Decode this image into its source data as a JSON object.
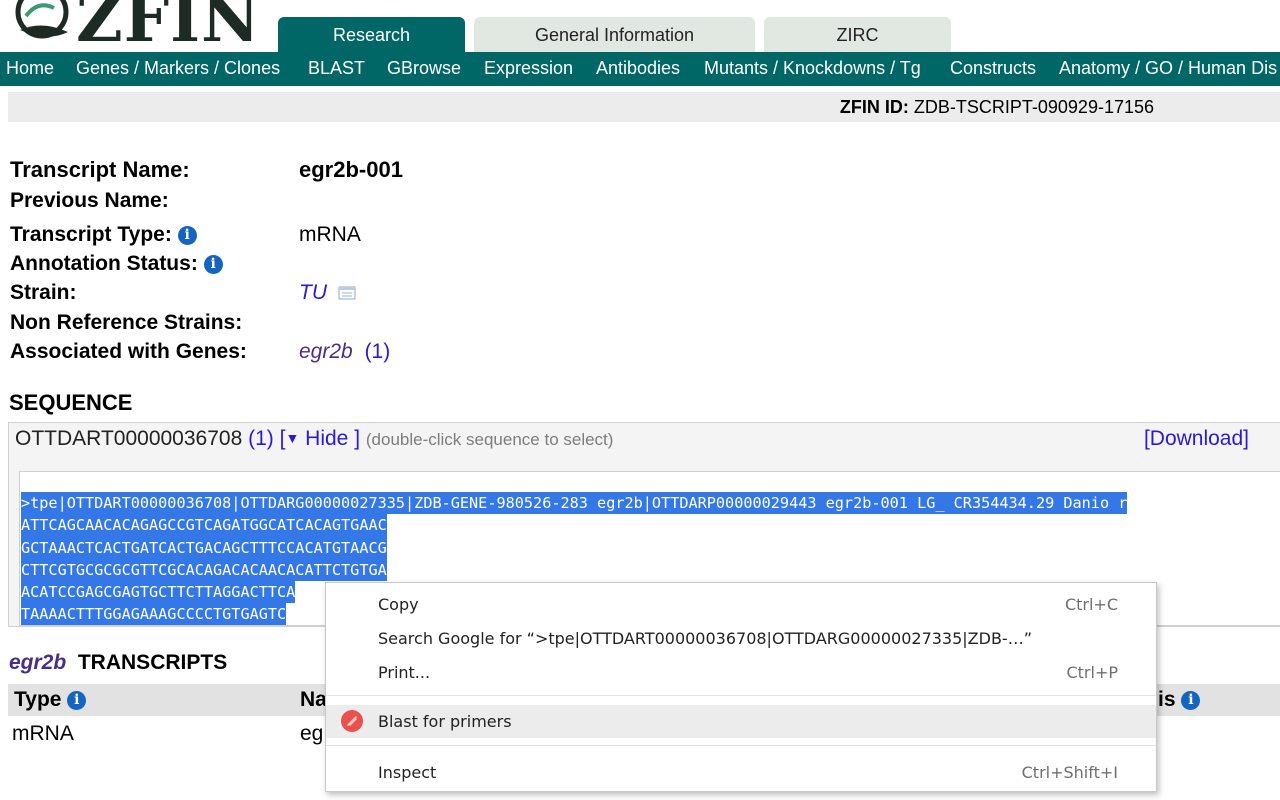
{
  "header": {
    "logo_text": "ZFIN",
    "tabs": [
      {
        "label": "Research",
        "active": true
      },
      {
        "label": "General Information",
        "active": false
      },
      {
        "label": "ZIRC",
        "active": false
      }
    ],
    "nav": [
      "Home",
      "Genes / Markers / Clones",
      "BLAST",
      "GBrowse",
      "Expression",
      "Antibodies",
      "Mutants / Knockdowns / Tg",
      "Constructs",
      "Anatomy / GO / Human Dis"
    ]
  },
  "zfin_id": {
    "label": "ZFIN ID:",
    "value": "ZDB-TSCRIPT-090929-17156"
  },
  "fields": {
    "transcript_name": {
      "label": "Transcript Name:",
      "value": "egr2b-001"
    },
    "previous_name": {
      "label": "Previous Name:"
    },
    "transcript_type": {
      "label": "Transcript Type:",
      "value": "mRNA"
    },
    "annotation_status": {
      "label": "Annotation Status:"
    },
    "strain": {
      "label": "Strain:",
      "value": "TU"
    },
    "non_reference_strains": {
      "label": "Non Reference Strains:"
    },
    "associated_genes": {
      "label": "Associated with Genes:",
      "gene": "egr2b",
      "count": "(1)"
    }
  },
  "sequence": {
    "title": "SEQUENCE",
    "accession": "OTTDART00000036708",
    "count": "(1)",
    "hide_label": "Hide",
    "hint": "(double-click sequence to select)",
    "download": "[Download]",
    "lines": [
      ">tpe|OTTDART00000036708|OTTDARG00000027335|ZDB-GENE-980526-283 egr2b|OTTDARP00000029443 egr2b-001 LG_ CR354434.29 Danio r",
      "ATTCAGCAACACAGAGCCGTCAGATGGCATCACAGTGAAC",
      "GCTAAACTCACTGATCACTGACAGCTTTCCACATGTAACG",
      "CTTCGTGCGCGCGTTCGCACAGACACAACACATTCTGTGA",
      "ACATCCGAGCGAGTGCTTCTTAGGACTTCA",
      "TAAAACTTTGGAGAAAGCCCCTGTGAGTC"
    ]
  },
  "transcripts": {
    "gene": "egr2b",
    "title": "TRANSCRIPTS",
    "columns": [
      "Type",
      "Na",
      "is"
    ],
    "row": {
      "type": "mRNA",
      "name": "eg"
    }
  },
  "context_menu": {
    "items": [
      {
        "label": "Copy",
        "shortcut": "Ctrl+C"
      },
      {
        "label": "Search Google for “>tpe|OTTDART00000036708|OTTDARG00000027335|ZDB-…”",
        "shortcut": ""
      },
      {
        "label": "Print...",
        "shortcut": "Ctrl+P"
      },
      {
        "label": "Blast for primers",
        "shortcut": "",
        "icon": "blast-primer-icon"
      },
      {
        "label": "Inspect",
        "shortcut": "Ctrl+Shift+I"
      }
    ]
  }
}
